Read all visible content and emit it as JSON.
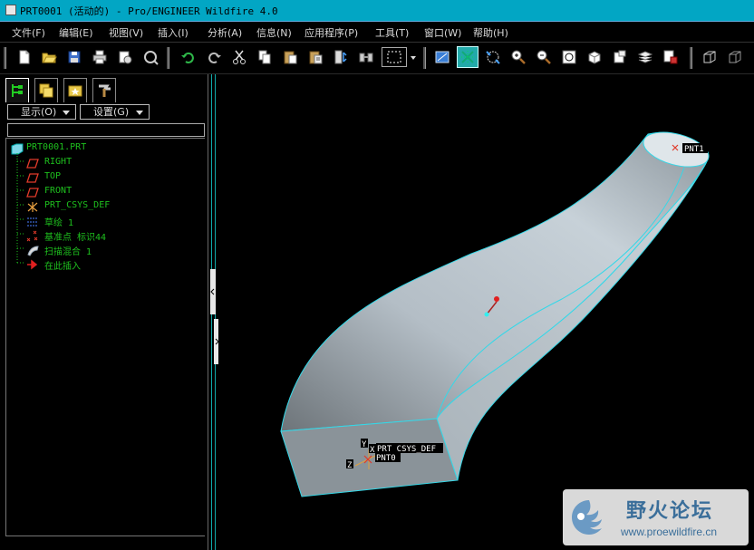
{
  "window": {
    "title": "PRT0001 (活动的) - Pro/ENGINEER Wildfire 4.0"
  },
  "menu": [
    {
      "label": "文件(F)"
    },
    {
      "label": "编辑(E)"
    },
    {
      "label": "视图(V)"
    },
    {
      "label": "插入(I)"
    },
    {
      "label": "分析(A)"
    },
    {
      "label": "信息(N)"
    },
    {
      "label": "应用程序(P)"
    },
    {
      "label": "工具(T)"
    },
    {
      "label": "窗口(W)"
    },
    {
      "label": "帮助(H)"
    }
  ],
  "toolbar": {
    "icons": [
      "new-file-icon",
      "open-folder-icon",
      "save-icon",
      "print-icon",
      "copy-pdf-icon",
      "regenerate-icon",
      "undo-icon",
      "redo-icon",
      "cut-icon",
      "copy-icon",
      "paste-icon",
      "paste-special-icon",
      "regenerate-model-icon",
      "find-icon",
      "select-box-icon",
      "repaint-icon",
      "orient-icon",
      "spin-center-icon",
      "zoom-in-icon",
      "zoom-out-icon",
      "refit-icon",
      "named-views-icon",
      "layers-icon",
      "view-manager-icon",
      "wireframe-icon",
      "hidden-line-icon"
    ]
  },
  "model_tree": {
    "tabs": [
      "model-tree-tab",
      "folder-browser-tab",
      "favorites-tab",
      "connections-tab"
    ],
    "show_label": "显示(O)",
    "settings_label": "设置(G)",
    "root": "PRT0001.PRT",
    "items": [
      {
        "label": "RIGHT",
        "icon": "datum-plane-icon"
      },
      {
        "label": "TOP",
        "icon": "datum-plane-icon"
      },
      {
        "label": "FRONT",
        "icon": "datum-plane-icon"
      },
      {
        "label": "PRT_CSYS_DEF",
        "icon": "csys-icon"
      },
      {
        "label": "草绘 1",
        "icon": "sketch-icon"
      },
      {
        "label": "基准点 标识44",
        "icon": "datum-point-icon"
      },
      {
        "label": "扫描混合 1",
        "icon": "swept-blend-icon"
      },
      {
        "label": "在此插入",
        "icon": "insert-here-arrow-icon"
      }
    ]
  },
  "viewport": {
    "labels": {
      "top_point": "PNT1",
      "csys": "PRT_CSYS_DEF",
      "bottom_point": "PNT0",
      "axis_x": "X",
      "axis_y": "Y",
      "axis_z": "Z"
    }
  },
  "watermark": {
    "title": "野火论坛",
    "url": "www.proewildfire.cn"
  },
  "colors": {
    "title_bar": "#02a6c4",
    "tree_text": "#1ec01e",
    "edge_highlight": "#34d8e8",
    "surface": "#b8c4cc"
  }
}
